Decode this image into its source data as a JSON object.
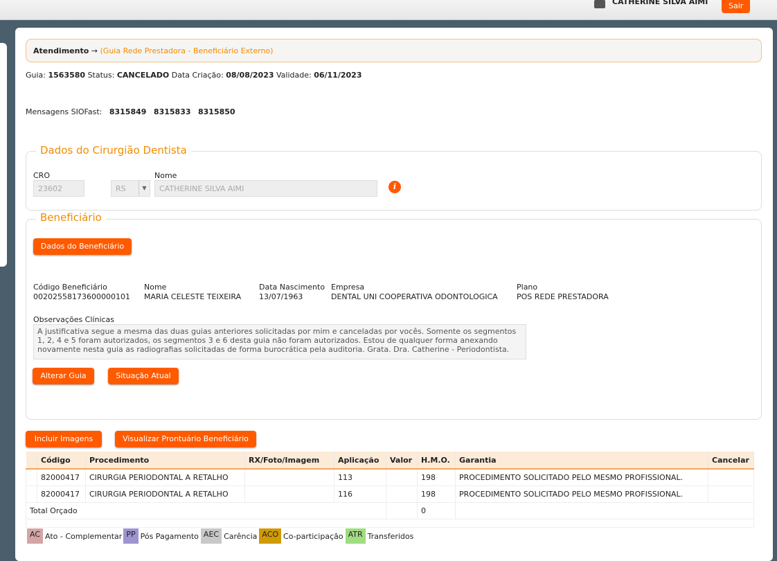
{
  "header": {
    "user": "CATHERINE SILVA AIMI",
    "logout": "Sair"
  },
  "breadcrumb": {
    "root": "Atendimento",
    "arrow": "→",
    "current": "(Guia Rede Prestadora - Beneficiário Externo)"
  },
  "info": {
    "guia_label": "Guia:",
    "guia": "1563580",
    "status_label": "Status:",
    "status": "CANCELADO",
    "criacao_label": "Data Criação:",
    "criacao": "08/08/2023",
    "validade_label": "Validade:",
    "validade": "06/11/2023"
  },
  "mensagens": {
    "label": "Mensagens SIOFast:",
    "items": [
      "8315849",
      "8315833",
      "8315850"
    ]
  },
  "dentista": {
    "title": "Dados do Cirurgião Dentista",
    "cro_label": "CRO",
    "cro": "23602",
    "uf": "RS",
    "nome_label": "Nome",
    "nome": "CATHERINE SILVA AIMI"
  },
  "beneficiario": {
    "title": "Beneficiário",
    "dados_btn": "Dados do Beneficiário",
    "codigo_label": "Código Beneficiário",
    "codigo": "00202558173600000101",
    "nome_label": "Nome",
    "nome": "MARIA CELESTE TEIXEIRA",
    "nasc_label": "Data Nascimento",
    "nasc": "13/07/1963",
    "empresa_label": "Empresa",
    "empresa": "DENTAL UNI COOPERATIVA ODONTOLOGICA",
    "plano_label": "Plano",
    "plano": "POS REDE PRESTADORA",
    "obs_label": "Observações Clínicas",
    "obs": "A justificativa segue a mesma das duas guias anteriores solicitadas por mim e canceladas por vocês. Somente os segmentos 1, 2, 4 e 5 foram autorizados, os segmentos 3 e 6 desta guia não foram autorizados. Estou de qualquer forma anexando novamente nesta guia as radiografias solicitadas de forma burocrática pela auditoria. Grata. Dra. Catherine - Periodontista.",
    "alterar_btn": "Alterar Guia",
    "situacao_btn": "Situação Atual"
  },
  "actions": {
    "incluir": "Incluir Imagens",
    "prontuario": "Visualizar Prontuário Beneficiário"
  },
  "table": {
    "headers": [
      "Código",
      "Procedimento",
      "RX/Foto/Imagem",
      "Aplicação",
      "Valor",
      "H.M.O.",
      "Garantia",
      "Cancelar"
    ],
    "rows": [
      {
        "codigo": "82000417",
        "procedimento": "CIRURGIA PERIODONTAL A RETALHO",
        "rx": "",
        "aplicacao": "113",
        "valor": "",
        "hmo": "198",
        "garantia": "PROCEDIMENTO SOLICITADO PELO MESMO PROFISSIONAL."
      },
      {
        "codigo": "82000417",
        "procedimento": "CIRURGIA PERIODONTAL A RETALHO",
        "rx": "",
        "aplicacao": "116",
        "valor": "",
        "hmo": "198",
        "garantia": "PROCEDIMENTO SOLICITADO PELO MESMO PROFISSIONAL."
      }
    ],
    "total_label": "Total Orçado",
    "total": "0"
  },
  "legend": [
    {
      "code": "AC",
      "label": "Ato - Complementar",
      "color": "#d4a5a5"
    },
    {
      "code": "PP",
      "label": "Pós Pagamento",
      "color": "#9e94d0"
    },
    {
      "code": "AEC",
      "label": "Carência",
      "color": "#c8c8c8"
    },
    {
      "code": "ACO",
      "label": "Co-participação",
      "color": "#d09a00"
    },
    {
      "code": "ATR",
      "label": "Transferidos",
      "color": "#a0dc80"
    }
  ]
}
